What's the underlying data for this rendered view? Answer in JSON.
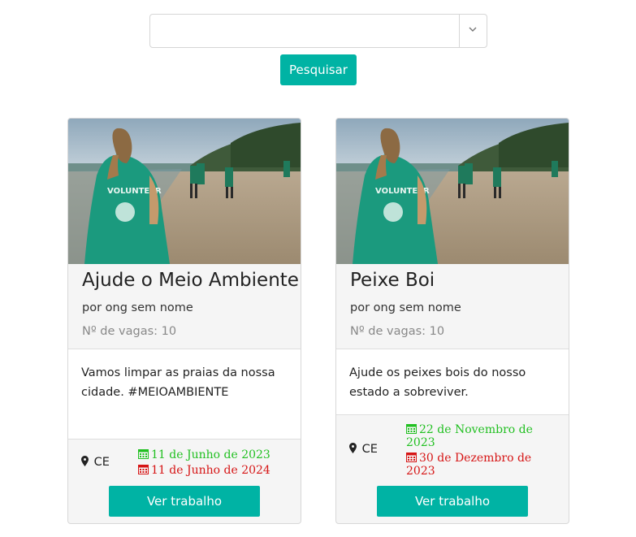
{
  "search": {
    "select_value": "",
    "button_label": "Pesquisar"
  },
  "colors": {
    "accent": "#00b3a4",
    "start_date": "#22c022",
    "end_date": "#d61515"
  },
  "cards": [
    {
      "title": "Ajude o Meio Ambiente",
      "org": "por ong sem nome",
      "vagas": "Nº de vagas: 10",
      "description": "Vamos limpar as praias da nossa cidade. #MEIOAMBIENTE",
      "location": "CE",
      "start_date": "11 de Junho de 2023",
      "end_date": "11 de Junho de 2024",
      "button_label": "Ver trabalho",
      "image_text": "VOLUNTEER"
    },
    {
      "title": "Peixe Boi",
      "org": "por ong sem nome",
      "vagas": "Nº de vagas: 10",
      "description": "Ajude os peixes bois do nosso estado a sobreviver.",
      "location": "CE",
      "start_date": "22 de Novembro de 2023",
      "end_date": "30 de Dezembro de 2023",
      "button_label": "Ver trabalho",
      "image_text": "VOLUNTEER"
    }
  ]
}
